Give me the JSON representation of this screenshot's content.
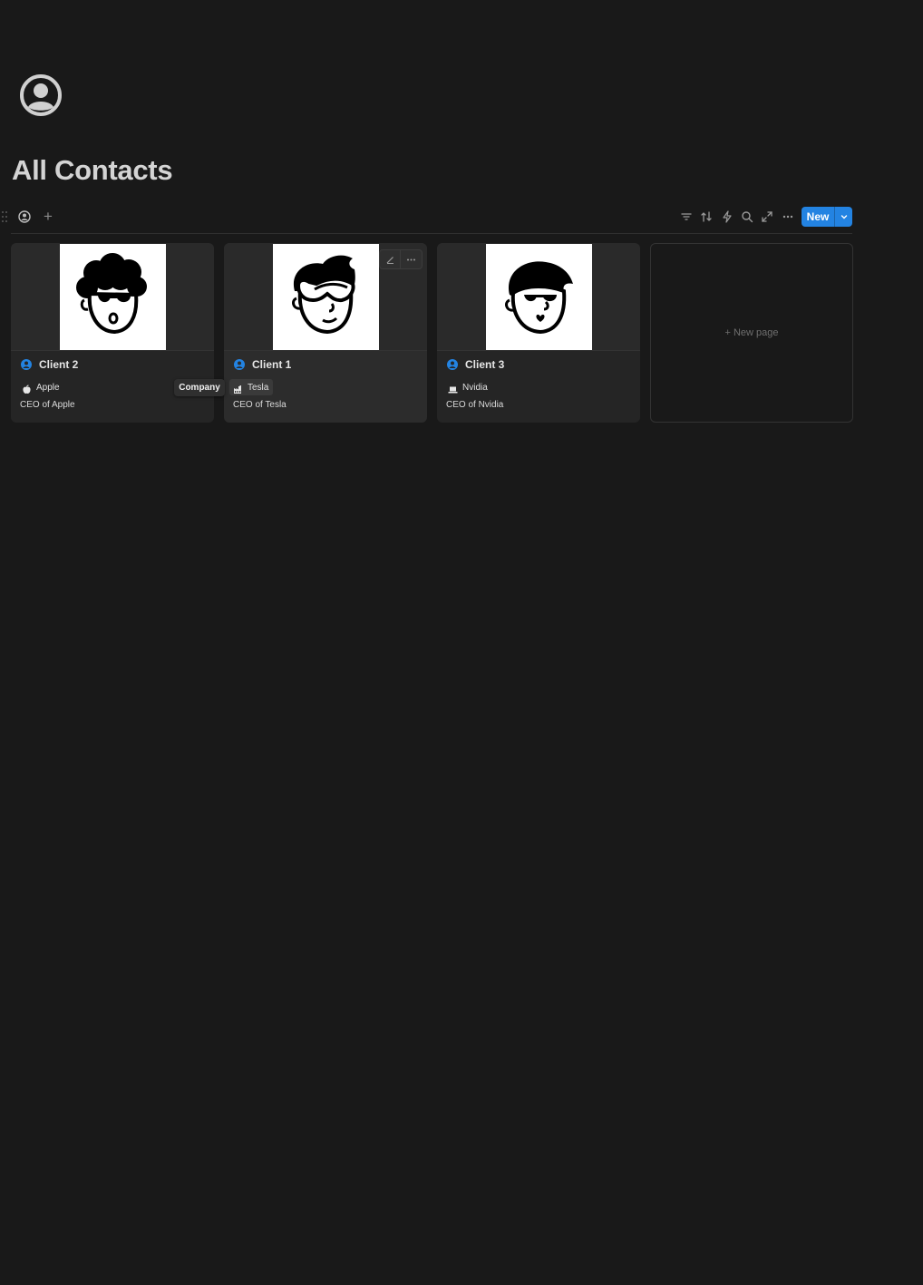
{
  "page": {
    "title": "All Contacts",
    "icon": "person-circle-icon"
  },
  "toolbar": {
    "view_icon": "database-view-icon",
    "add_view": "+",
    "tools": [
      "filter-icon",
      "sort-icon",
      "automation-icon",
      "search-icon",
      "expand-icon",
      "more-icon"
    ],
    "new_label": "New"
  },
  "cards": [
    {
      "title": "Client 2",
      "company": "Apple",
      "company_icon": "apple-icon",
      "role": "CEO of Apple",
      "avatar": "curly-hair-sunglasses-avatar"
    },
    {
      "title": "Client 1",
      "company": "Tesla",
      "company_icon": "factory-icon",
      "role": "CEO of Tesla",
      "avatar": "spiky-hair-goggles-avatar"
    },
    {
      "title": "Client 3",
      "company": "Nvidia",
      "company_icon": "laptop-icon",
      "role": "CEO of Nvidia",
      "avatar": "swoop-hair-sunglasses-avatar"
    }
  ],
  "tooltip": {
    "text": "Company"
  },
  "new_page": {
    "label": "New page"
  },
  "colors": {
    "accent": "#2383e2",
    "background": "#191919",
    "card": "#252525"
  }
}
